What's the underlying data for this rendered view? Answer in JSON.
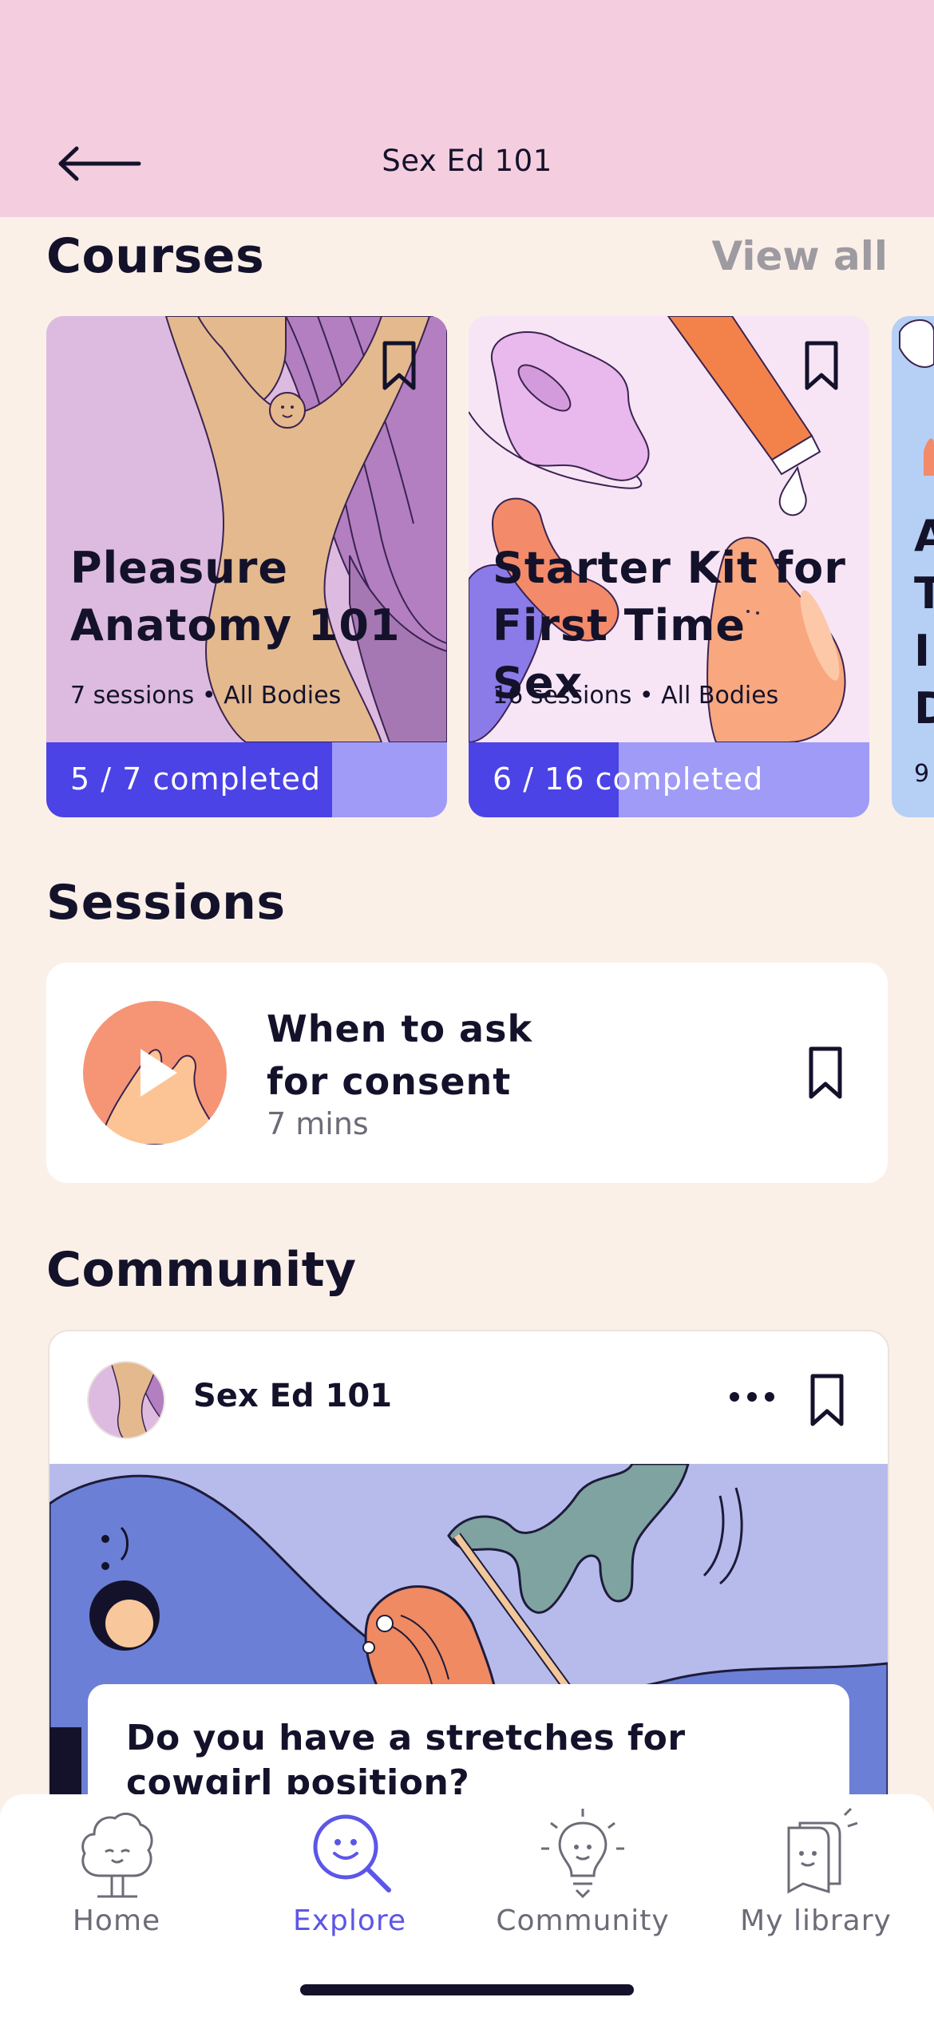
{
  "header": {
    "title": "Sex Ed 101",
    "back_icon": "back-arrow-icon"
  },
  "courses": {
    "title": "Courses",
    "view_all": "View all",
    "items": [
      {
        "title_line1": "Pleasure",
        "title_line2": "Anatomy 101",
        "meta": "7 sessions • All Bodies",
        "progress_label": "5 / 7 completed",
        "progress": 0.714,
        "bg": "#DDBBE0"
      },
      {
        "title_line1": "Starter Kit for",
        "title_line2": "First Time Sex",
        "meta": "16 sessions • All Bodies",
        "progress_label": "6 / 16 completed",
        "progress": 0.375,
        "bg": "#F7E5F6"
      },
      {
        "title_line1": "A",
        "title_line2": "T",
        "title_line3": "I",
        "title_line4": "D",
        "meta": "9",
        "bg": "#B6CFF5"
      }
    ]
  },
  "sessions": {
    "title": "Sessions",
    "item": {
      "title_line1": "When to ask",
      "title_line2": "for consent",
      "duration": "7 mins"
    }
  },
  "community": {
    "title": "Community",
    "post": {
      "author": "Sex Ed 101",
      "question_line1": "Do you have a stretches for",
      "question_line2": "cowgirl position?"
    }
  },
  "tabbar": {
    "items": [
      {
        "label": "Home",
        "icon": "tree-icon",
        "active": false
      },
      {
        "label": "Explore",
        "icon": "search-smile-icon",
        "active": true
      },
      {
        "label": "Community",
        "icon": "lightbulb-icon",
        "active": false
      },
      {
        "label": "My library",
        "icon": "library-icon",
        "active": false
      }
    ]
  },
  "colors": {
    "accent": "#4B43E5",
    "progress_track": "#9F9BF7",
    "header_bg": "#F4CDDF",
    "page_bg": "#FBF0E8"
  }
}
